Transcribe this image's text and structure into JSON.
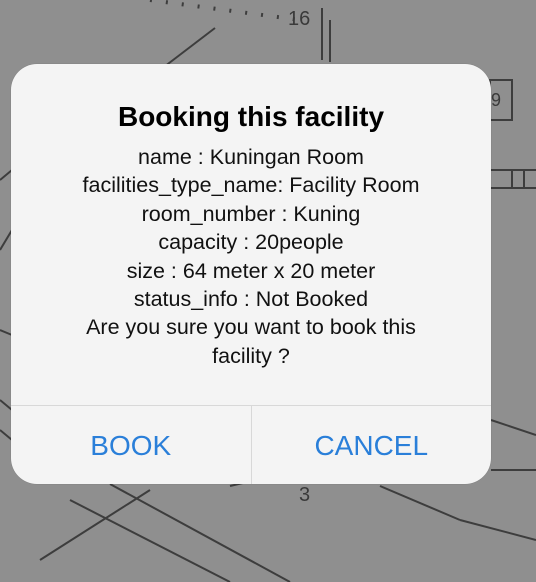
{
  "background_map": {
    "label_top": "16",
    "label_bottom": "3",
    "label_right": "9"
  },
  "alert": {
    "title": "Booking this facility",
    "lines": [
      "name : Kuningan Room",
      "facilities_type_name:  Facility Room",
      "room_number : Kuning",
      "capacity : 20people",
      "size : 64 meter x 20 meter",
      "status_info : Not Booked"
    ],
    "question": "Are you sure you want to book this facility ?",
    "buttons": {
      "book": "BOOK",
      "cancel": "CANCEL"
    },
    "accent_color": "#2a7fd9"
  }
}
